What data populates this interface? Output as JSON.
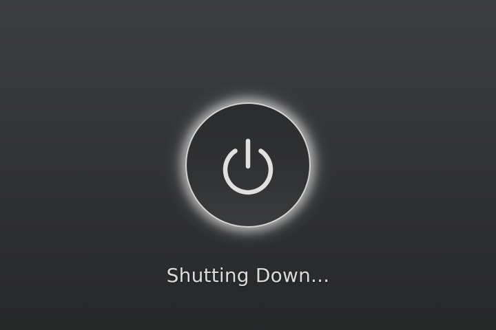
{
  "status": {
    "message": "Shutting Down..."
  },
  "power_button": {
    "icon": "power-icon"
  },
  "colors": {
    "background_top": "#3c3d3f",
    "background_bottom": "#262728",
    "ring": "#d6d6d6",
    "icon": "#e0e0e0",
    "text": "#dcdcdc"
  }
}
